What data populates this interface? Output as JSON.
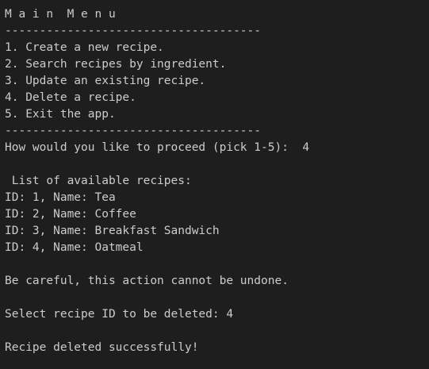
{
  "terminal": {
    "lines": [
      "M a i n  M e n u",
      "-------------------------------------",
      "1. Create a new recipe.",
      "2. Search recipes by ingredient.",
      "3. Update an existing recipe.",
      "4. Delete a recipe.",
      "5. Exit the app.",
      "-------------------------------------",
      "How would you like to proceed (pick 1-5):  4",
      "",
      " List of available recipes:",
      "ID: 1, Name: Tea",
      "ID: 2, Name: Coffee",
      "ID: 3, Name: Breakfast Sandwich",
      "ID: 4, Name: Oatmeal",
      "",
      "Be careful, this action cannot be undone.",
      "",
      "Select recipe ID to be deleted: 4",
      "",
      "Recipe deleted successfully!"
    ]
  }
}
